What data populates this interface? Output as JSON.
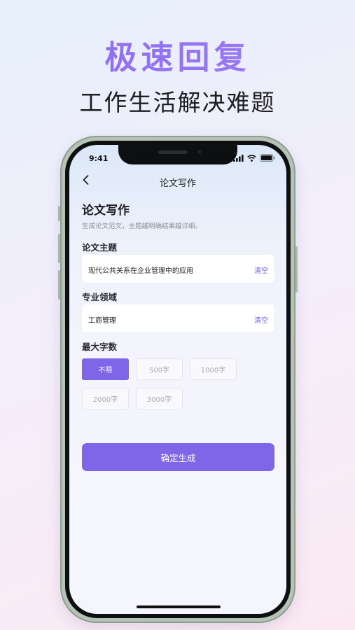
{
  "promo": {
    "headline": "极速回复",
    "subheadline": "工作生活解决难题"
  },
  "status_bar": {
    "time": "9:41",
    "icons": [
      "cellular-signal-icon",
      "wifi-icon",
      "battery-icon"
    ]
  },
  "nav": {
    "title": "论文写作",
    "back_icon": "chevron-left-icon"
  },
  "page": {
    "heading": "论文写作",
    "description": "生成论文范文，主题越明确结果越详细。"
  },
  "fields": {
    "topic": {
      "label": "论文主题",
      "value": "现代公共关系在企业管理中的应用",
      "clear_label": "清空"
    },
    "domain": {
      "label": "专业领域",
      "value": "工商管理",
      "clear_label": "清空"
    }
  },
  "word_limit": {
    "label": "最大字数",
    "options": [
      "不限",
      "500字",
      "1000字",
      "2000字",
      "3000字"
    ],
    "selected": "不限"
  },
  "confirm_button": {
    "label": "确定生成"
  },
  "colors": {
    "accent": "#7f66e8",
    "headline_gradient_start": "#8a6bf0",
    "phone_frame": "#b5c3b7"
  }
}
